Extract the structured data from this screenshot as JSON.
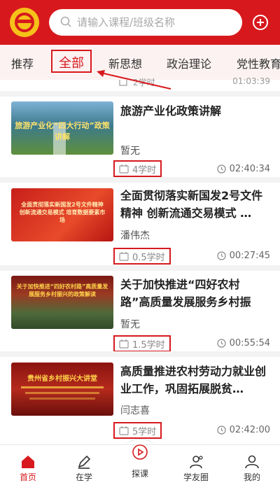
{
  "header": {
    "search_placeholder": "请输入课程/班级名称"
  },
  "tabs": [
    {
      "label": "推荐"
    },
    {
      "label": "全部"
    },
    {
      "label": "新思想"
    },
    {
      "label": "政治理论"
    },
    {
      "label": "党性教育"
    }
  ],
  "active_tab": "全部",
  "courses": [
    {
      "title": "旅游产业化政策讲解",
      "author": "暂无",
      "hours": "4学时",
      "duration": "02:40:34",
      "thumb_text": "旅游产业化“四大行动”政策讲解"
    },
    {
      "title": "全面贯彻落实新国发2号文件精神 创新流通交易模式 …",
      "author": "潘伟杰",
      "hours": "0.5学时",
      "duration": "00:27:45",
      "thumb_text": "全面贯彻落实新国发2号文件精神 创新流通交易模式 培育数据要素市场"
    },
    {
      "title": "关于加快推进“四好农村路”高质量发展服务乡村振兴…",
      "author": "暂无",
      "hours": "1.5学时",
      "duration": "00:55:54",
      "thumb_text": "关于加快推进“四好农村路”高质量发展服务乡村振兴的政策解读"
    },
    {
      "title": "高质量推进农村劳动力就业创业工作，巩固拓展脱贫…",
      "author": "闫志喜",
      "hours": "5学时",
      "duration": "02:42:00",
      "thumb_text": "贵州省乡村振兴大讲堂"
    }
  ],
  "partial_top": {
    "hours": "2学时",
    "duration": "01:03:39"
  },
  "bottom_nav": [
    {
      "label": "首页",
      "icon": "home-icon"
    },
    {
      "label": "在学",
      "icon": "pen-icon"
    },
    {
      "label": "探课",
      "icon": "play-icon"
    },
    {
      "label": "学友圈",
      "icon": "friends-icon"
    },
    {
      "label": "我的",
      "icon": "user-icon"
    }
  ],
  "colors": {
    "brand_red": "#d7191d",
    "logo_yellow": "#f6c219",
    "tab_bg": "#fdf2f2"
  }
}
